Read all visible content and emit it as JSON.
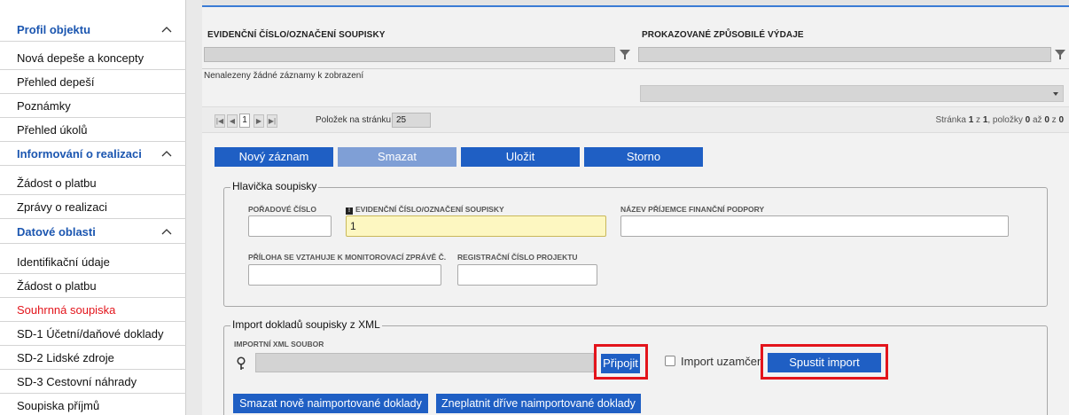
{
  "sidebar": {
    "items": [
      {
        "label": "Profil objektu",
        "type": "header"
      },
      {
        "label": "Nová depeše a koncepty",
        "type": "item"
      },
      {
        "label": "Přehled depeší",
        "type": "item"
      },
      {
        "label": "Poznámky",
        "type": "item"
      },
      {
        "label": "Přehled úkolů",
        "type": "item"
      },
      {
        "label": "Informování o realizaci",
        "type": "header"
      },
      {
        "label": "Žádost o platbu",
        "type": "item"
      },
      {
        "label": "Zprávy o realizaci",
        "type": "item"
      },
      {
        "label": "Datové oblasti",
        "type": "header"
      },
      {
        "label": "Identifikační údaje",
        "type": "item"
      },
      {
        "label": "Žádost o platbu",
        "type": "item"
      },
      {
        "label": "Souhrnná soupiska",
        "type": "active"
      },
      {
        "label": "SD-1 Účetní/daňové doklady",
        "type": "item"
      },
      {
        "label": "SD-2 Lidské zdroje",
        "type": "item"
      },
      {
        "label": "SD-3 Cestovní náhrady",
        "type": "item"
      },
      {
        "label": "Soupiska příjmů",
        "type": "item"
      }
    ]
  },
  "grid": {
    "col1": "EVIDENČNÍ ČÍSLO/OZNAČENÍ SOUPISKY",
    "col2": "PROKAZOVANÉ ZPŮSOBILÉ VÝDAJE",
    "empty_message": "Nenalezeny žádné záznamy k zobrazení"
  },
  "pager": {
    "first": "|◀",
    "prev": "◀",
    "current_page": "1",
    "next": "▶",
    "last": "▶|",
    "page_size_label": "Položek na stránku",
    "page_size": "25",
    "info_prefix": "Stránka",
    "info_page": "1",
    "info_of": "z",
    "info_pages": "1",
    "info_items": ", položky",
    "info_from": "0",
    "info_to_word": "až",
    "info_to": "0",
    "info_total_word": "z",
    "info_total": "0"
  },
  "toolbar": {
    "new": "Nový záznam",
    "delete": "Smazat",
    "save": "Uložit",
    "cancel": "Storno"
  },
  "header_group": {
    "legend": "Hlavička soupisky",
    "order_label": "POŘADOVÉ ČÍSLO",
    "order_value": "",
    "evid_badge": "!",
    "evid_label": "EVIDENČNÍ ČÍSLO/OZNAČENÍ SOUPISKY",
    "evid_value": "1",
    "recipient_label": "NÁZEV PŘÍJEMCE FINANČNÍ PODPORY",
    "recipient_value": "",
    "attachment_label": "PŘÍLOHA SE VZTAHUJE K MONITOROVACÍ ZPRÁVĚ Č.",
    "attachment_value": "",
    "regnum_label": "REGISTRAČNÍ ČÍSLO PROJEKTU",
    "regnum_value": ""
  },
  "import_group": {
    "legend": "Import dokladů soupisky z XML",
    "file_label": "IMPORTNÍ XML SOUBOR",
    "attach_button": "Připojit",
    "lock_label": "Import uzamčen",
    "run_button": "Spustit import",
    "delete_new_button": "Smazat nově naimportované doklady",
    "invalidate_button": "Zneplatnit dříve naimportované doklady"
  },
  "colors": {
    "accent": "#1f5fc4",
    "header_text": "#1b56b0",
    "active_text": "#e3141b",
    "highlight_box": "#e3141b"
  }
}
